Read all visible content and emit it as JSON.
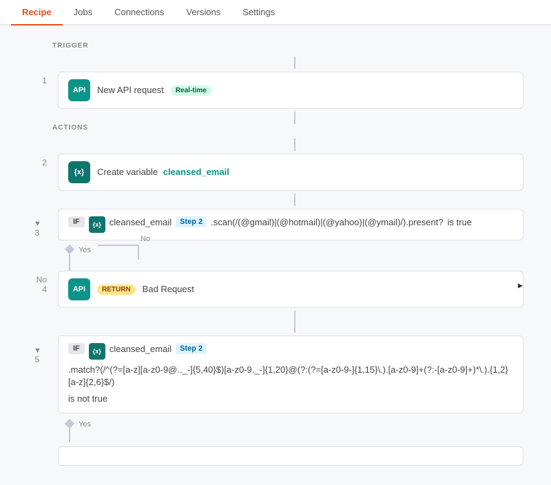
{
  "tabs": [
    {
      "label": "Recipe",
      "active": true
    },
    {
      "label": "Jobs",
      "active": false
    },
    {
      "label": "Connections",
      "active": false
    },
    {
      "label": "Versions",
      "active": false
    },
    {
      "label": "Settings",
      "active": false
    }
  ],
  "sections": {
    "trigger_label": "TRIGGER",
    "actions_label": "ACTIONS"
  },
  "steps": {
    "step1": {
      "number": "1",
      "icon_type": "api",
      "icon_label": "API",
      "title": "New API request",
      "badge": "Real-time"
    },
    "step2": {
      "number": "2",
      "icon_type": "variable",
      "icon_label": "{x}",
      "prefix": "Create variable",
      "variable_name": "cleansed_email"
    },
    "step3": {
      "number": "3",
      "collapsed": true,
      "if_label": "IF",
      "icon_label": "{x}",
      "var_name": "cleansed_email",
      "step_ref": "Step 2",
      "condition_code": ".scan(/(@gmail)|(@hotmail)|(@yahoo)|(@ymail)/).present?",
      "condition_suffix": "is true",
      "yes_label": "Yes",
      "no_label": "No"
    },
    "step4": {
      "number": "4",
      "icon_type": "api",
      "icon_label": "API",
      "badge": "RETURN",
      "title": "Bad Request"
    },
    "step5": {
      "number": "5",
      "collapsed": true,
      "if_label": "IF",
      "icon_label": "{x}",
      "var_name": "cleansed_email",
      "step_ref": "Step 2",
      "condition_code": ".match?(/^(?=[a-z][a-z0-9@.._-]{5,40}$)[a-z0-9._-]{1,20}@(?:(?=[a-z0-9-]{1,15}\\.).[a-z0-9]+(?:-[a-z0-9]+)*\\.).{1,2}[a-z]{2,6}$/)",
      "condition_suffix": "is not true",
      "yes_label": "Yes"
    }
  }
}
